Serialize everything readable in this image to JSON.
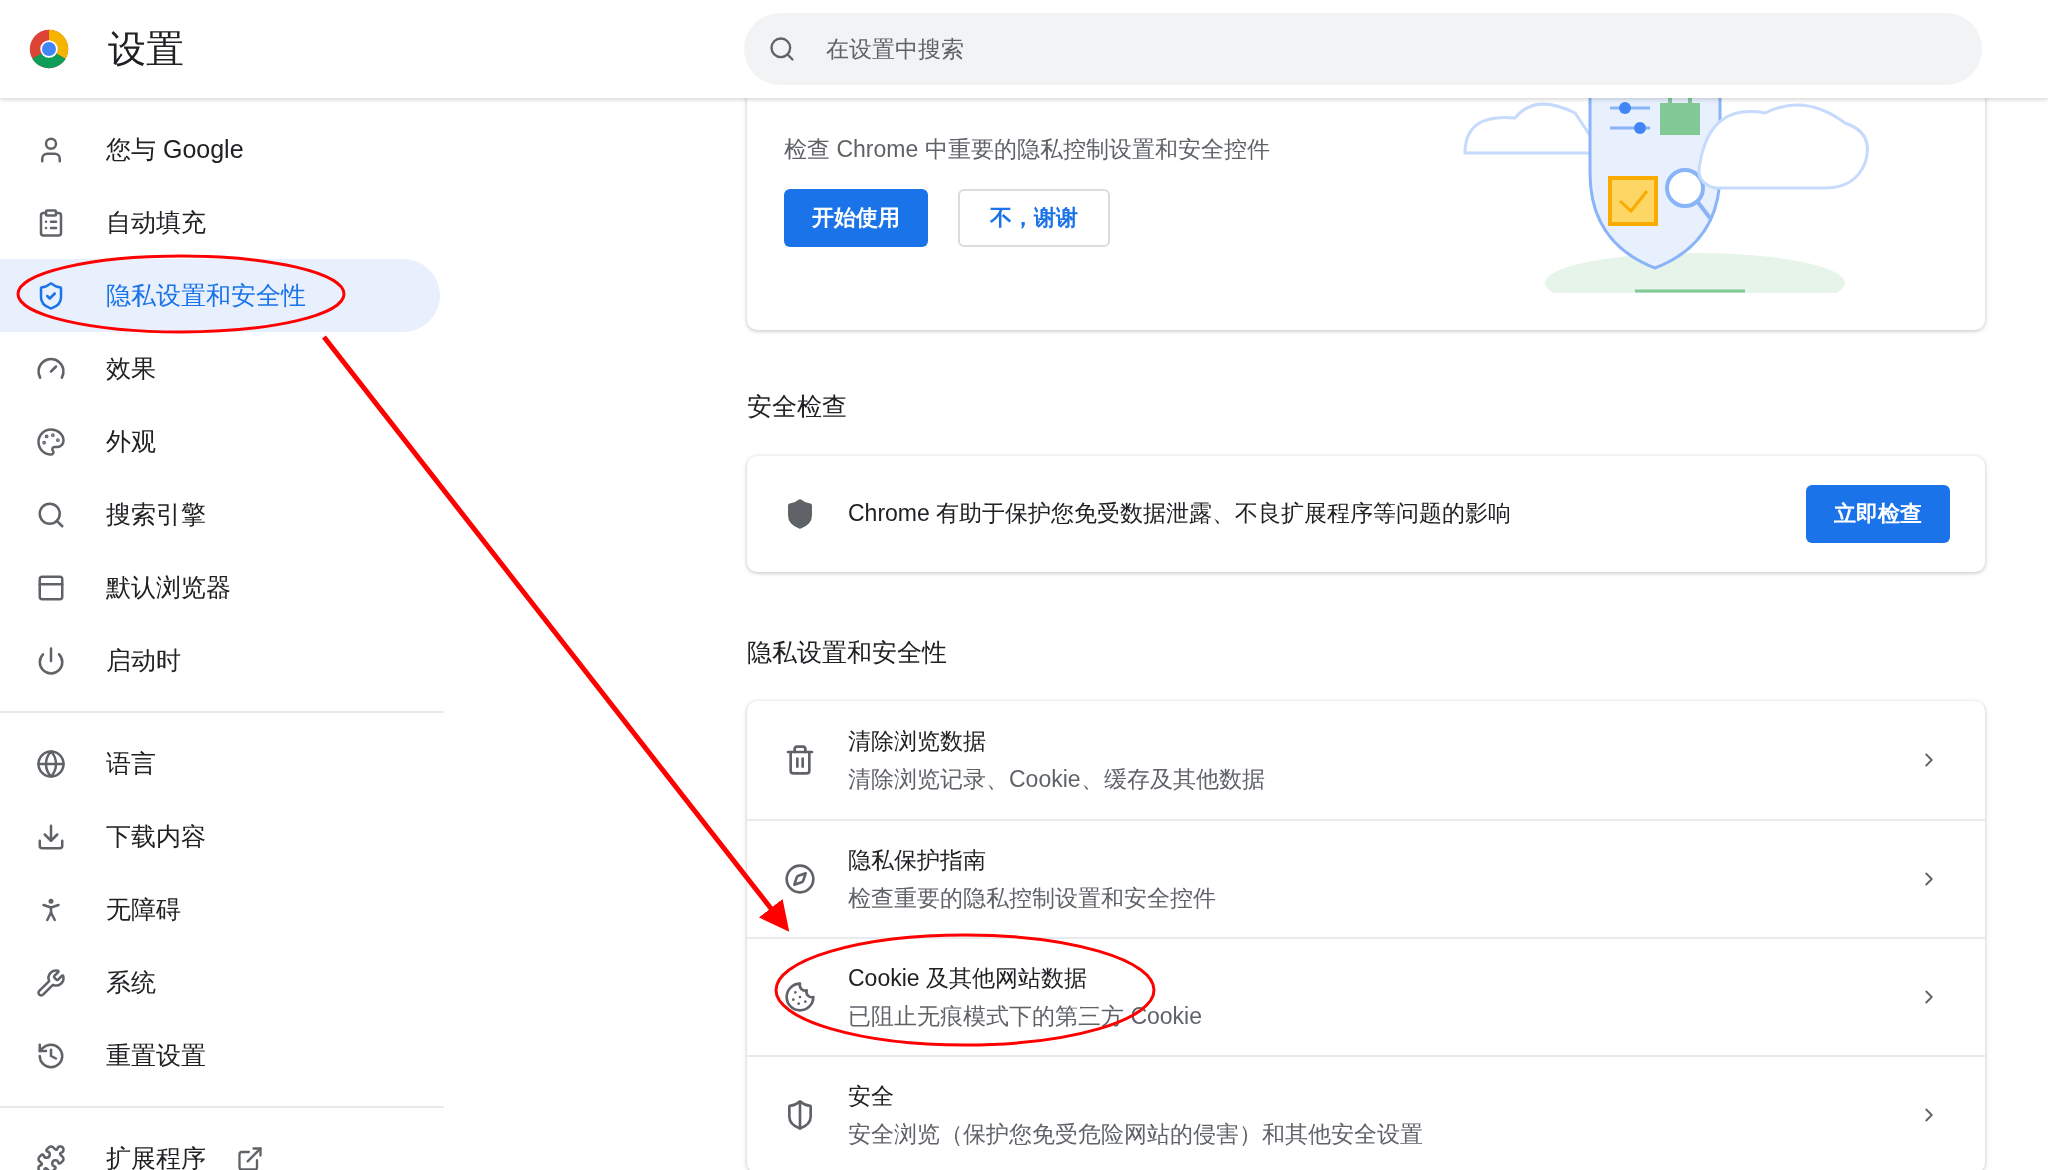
{
  "header": {
    "title": "设置",
    "search": {
      "placeholder": "在设置中搜索"
    }
  },
  "sidebar": {
    "groups": [
      {
        "items": [
          {
            "label": "您与 Google",
            "selected": false
          },
          {
            "label": "自动填充",
            "selected": false
          },
          {
            "label": "隐私设置和安全性",
            "selected": true
          },
          {
            "label": "效果",
            "selected": false
          },
          {
            "label": "外观",
            "selected": false
          },
          {
            "label": "搜索引擎",
            "selected": false
          },
          {
            "label": "默认浏览器",
            "selected": false
          },
          {
            "label": "启动时",
            "selected": false
          }
        ]
      },
      {
        "items": [
          {
            "label": "语言",
            "selected": false
          },
          {
            "label": "下载内容",
            "selected": false
          },
          {
            "label": "无障碍",
            "selected": false
          },
          {
            "label": "系统",
            "selected": false
          },
          {
            "label": "重置设置",
            "selected": false
          }
        ]
      },
      {
        "items": [
          {
            "label": "扩展程序",
            "selected": false
          }
        ]
      }
    ]
  },
  "guide_card": {
    "description": "检查 Chrome 中重要的隐私控制设置和安全控件",
    "buttons": [
      {
        "label": "开始使用",
        "kind": "primary"
      },
      {
        "label": "不，谢谢",
        "kind": "secondary"
      }
    ]
  },
  "safety_check": {
    "heading": "安全检查",
    "text": "Chrome 有助于保护您免受数据泄露、不良扩展程序等问题的影响",
    "button": "立即检查"
  },
  "privacy": {
    "heading": "隐私设置和安全性",
    "rows": [
      {
        "title": "清除浏览数据",
        "subtitle": "清除浏览记录、Cookie、缓存及其他数据"
      },
      {
        "title": "隐私保护指南",
        "subtitle": "检查重要的隐私控制设置和安全控件"
      },
      {
        "title": "Cookie 及其他网站数据",
        "subtitle": "已阻止无痕模式下的第三方 Cookie"
      },
      {
        "title": "安全",
        "subtitle": "安全浏览（保护您免受危险网站的侵害）和其他安全设置"
      }
    ]
  }
}
